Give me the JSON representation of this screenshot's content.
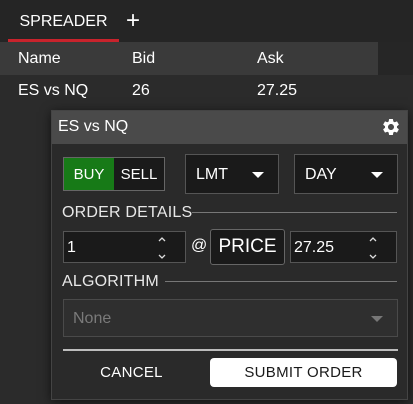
{
  "tabs": {
    "active_label": "SPREADER",
    "add_symbol": "+"
  },
  "table": {
    "headers": [
      "Name",
      "Bid",
      "Ask"
    ],
    "rows": [
      [
        "ES vs NQ",
        "26",
        "27.25"
      ]
    ]
  },
  "order_dialog": {
    "title": "ES vs NQ",
    "buy_label": "BUY",
    "sell_label": "SELL",
    "selected_side": "BUY",
    "order_type": "LMT",
    "time_in_force": "DAY",
    "order_details_label": "ORDER DETAILS",
    "quantity": "1",
    "at_symbol": "@",
    "price_type_label": "PRICE",
    "price": "27.25",
    "algorithm_label": "ALGORITHM",
    "algorithm_value": "None",
    "cancel_label": "CANCEL",
    "submit_label": "SUBMIT ORDER"
  },
  "colors": {
    "buy_active": "#177a17",
    "tab_accent": "#c8232c",
    "background": "#2b2b2b",
    "dialog_header": "#4a4a4a"
  },
  "icons": {
    "add_tab": "plus-icon",
    "settings": "gear-icon",
    "dropdown": "chevron-down-icon",
    "spinner": "up-down-arrows-icon"
  }
}
